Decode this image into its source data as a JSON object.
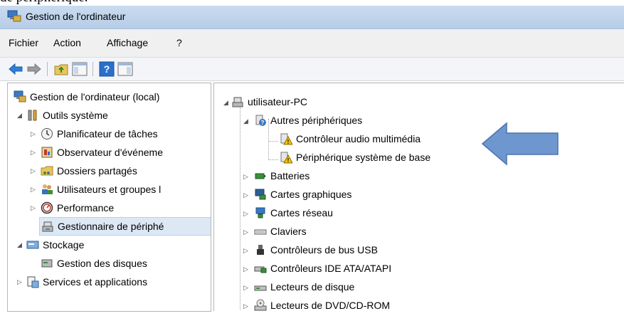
{
  "doc_text": "de périphérique.",
  "window": {
    "title": "Gestion de l'ordinateur"
  },
  "menu": [
    "Fichier",
    "Action",
    "Affichage",
    "?"
  ],
  "left_tree": {
    "root": "Gestion de l'ordinateur (local)",
    "system_tools": "Outils système",
    "system_tools_items": [
      "Planificateur de tâches",
      "Observateur d'événeme",
      "Dossiers partagés",
      "Utilisateurs et groupes l",
      "Performance",
      "Gestionnaire de périphé"
    ],
    "storage": "Stockage",
    "disk_mgmt": "Gestion des disques",
    "services": "Services et applications"
  },
  "device_tree": {
    "computer": "utilisateur-PC",
    "other_devices": "Autres périphériques",
    "other_items": [
      "Contrôleur audio multimédia",
      "Périphérique système de base"
    ],
    "categories": [
      "Batteries",
      "Cartes graphiques",
      "Cartes réseau",
      "Claviers",
      "Contrôleurs de bus USB",
      "Contrôleurs IDE ATA/ATAPI",
      "Lecteurs de disque",
      "Lecteurs de DVD/CD-ROM"
    ]
  },
  "colors": {
    "arrow": "#6f97cf",
    "titlebar": "#c9dbef",
    "selection": "#dde8f5",
    "warning": "#f5c400"
  }
}
